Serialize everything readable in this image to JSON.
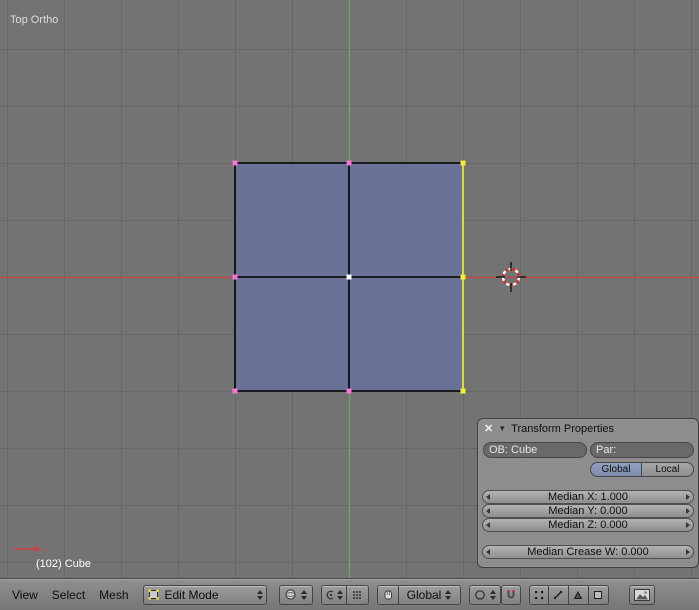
{
  "viewport": {
    "view_label": "Top Ortho",
    "frame_object_label": "(102) Cube",
    "axis_x_label": "x",
    "colors": {
      "background": "#737373",
      "grid": "#676767",
      "axis_x": "#bc4b4b",
      "axis_y": "#5fae5f",
      "face": "#68719a",
      "edge": "#000000",
      "edge_selected": "#eee829",
      "vertex": "#f773d8",
      "vertex_selected": "#f2ef2c",
      "vertex_active": "#ffffff",
      "cursor_red": "#cc3333",
      "cursor_white": "#ffffff"
    }
  },
  "panel": {
    "title": "Transform Properties",
    "icons": {
      "close": "✕",
      "collapse": "▼"
    },
    "ob_field": "OB: Cube",
    "par_field": "Par:",
    "space_buttons": {
      "global": "Global",
      "local": "Local"
    },
    "sliders": [
      "Median X: 1.000",
      "Median Y: 0.000",
      "Median Z: 0.000"
    ],
    "crease_slider": "Median Crease W: 0.000"
  },
  "header": {
    "menus": [
      "View",
      "Select",
      "Mesh"
    ],
    "mode_dropdown": "Edit Mode",
    "orientation_dropdown": "Global"
  }
}
